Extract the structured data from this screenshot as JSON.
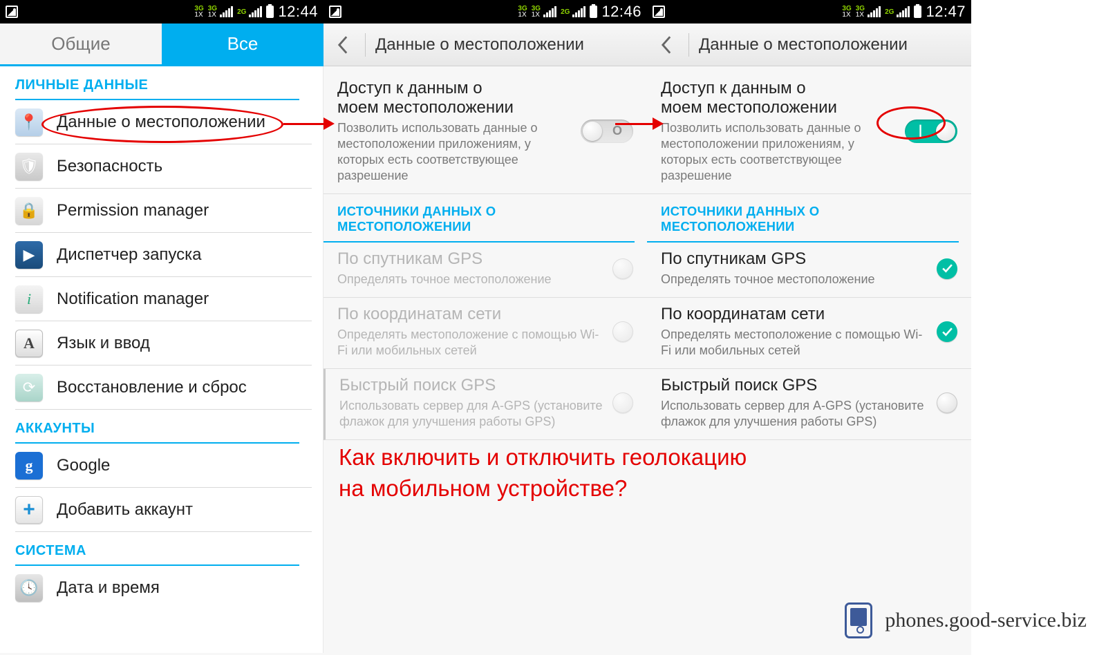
{
  "status": {
    "net1_top": "3G",
    "net1_bot": "1X",
    "net2_top": "3G",
    "net2_bot": "1X",
    "net3_top": "2G",
    "times": [
      "12:44",
      "12:46",
      "12:47"
    ]
  },
  "screen1": {
    "tab_general": "Общие",
    "tab_all": "Все",
    "section_personal": "ЛИЧНЫЕ ДАННЫЕ",
    "items": {
      "location": "Данные о местоположении",
      "security": "Безопасность",
      "permission": "Permission manager",
      "dispatcher": "Диспетчер запуска",
      "notification": "Notification manager",
      "lang": "Язык и ввод",
      "recovery": "Восстановление и сброс"
    },
    "section_accounts": "АККАУНТЫ",
    "accounts": {
      "google": "Google",
      "add": "Добавить аккаунт"
    },
    "section_system": "СИСТЕМА",
    "system": {
      "datetime": "Дата и время"
    }
  },
  "loc": {
    "title": "Данные о местоположении",
    "access_title_l1": "Доступ к данным о",
    "access_title_l2": "моем местоположении",
    "access_desc": "Позволить использовать данные о местоположении приложениям, у которых есть соответствующее разрешение",
    "sources_header": "ИСТОЧНИКИ ДАННЫХ О МЕСТОПОЛОЖЕНИИ",
    "gps_title": "По спутникам GPS",
    "gps_desc": "Определять точное местоположение",
    "net_title": "По координатам сети",
    "net_desc": "Определять местоположение с помощью Wi-Fi или мобильных сетей",
    "agps_title": "Быстрый поиск GPS",
    "agps_desc": "Использовать сервер для A-GPS (установите флажок для улучшения работы GPS)"
  },
  "caption_l1": "Как включить и отключить геолокацию",
  "caption_l2": "на мобильном устройстве?",
  "watermark": "phones.good-service.biz"
}
